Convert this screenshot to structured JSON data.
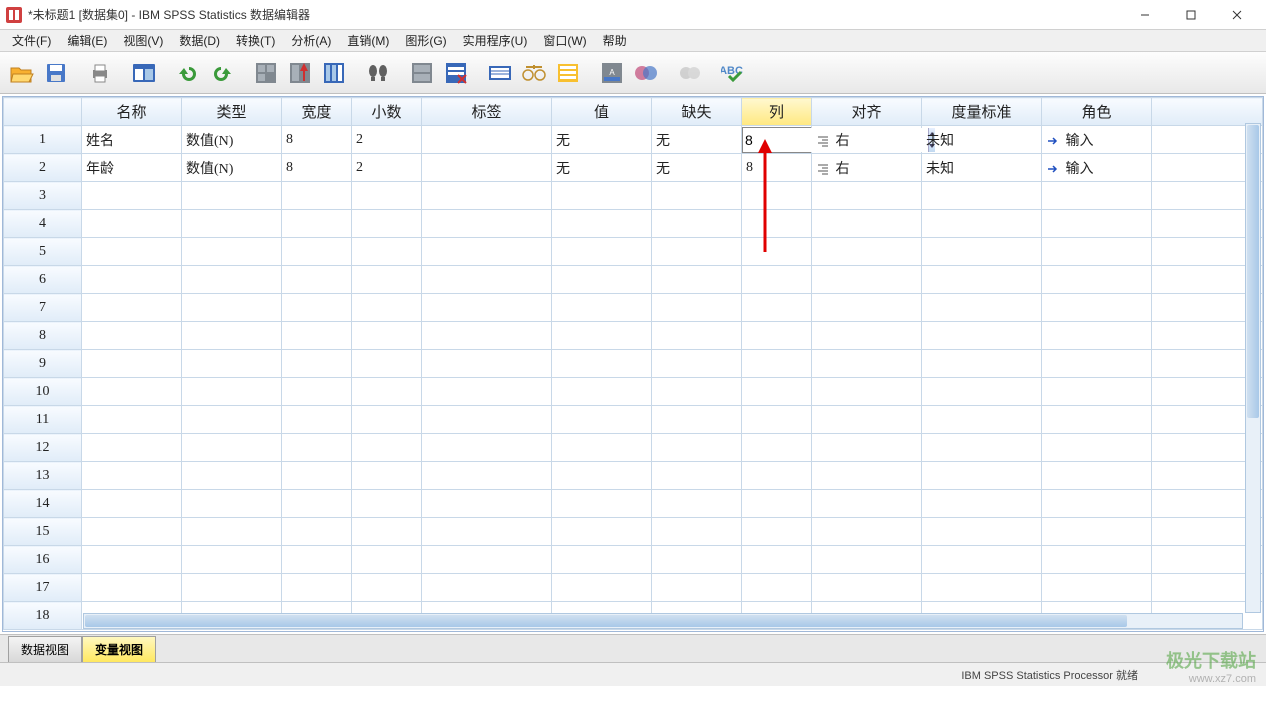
{
  "window": {
    "title": "*未标题1 [数据集0] - IBM SPSS Statistics 数据编辑器"
  },
  "menu": {
    "file": "文件(F)",
    "edit": "编辑(E)",
    "view": "视图(V)",
    "data": "数据(D)",
    "transform": "转换(T)",
    "analyze": "分析(A)",
    "direct": "直销(M)",
    "graphs": "图形(G)",
    "utilities": "实用程序(U)",
    "window": "窗口(W)",
    "help": "帮助"
  },
  "columns": {
    "name": "名称",
    "type": "类型",
    "width": "宽度",
    "decimals": "小数",
    "label": "标签",
    "values": "值",
    "missing": "缺失",
    "columns": "列",
    "align": "对齐",
    "measure": "度量标准",
    "role": "角色"
  },
  "rows": [
    {
      "idx": "1",
      "name": "姓名",
      "type": "数值(N)",
      "width": "8",
      "decimals": "2",
      "label": "",
      "values": "无",
      "missing": "无",
      "columns": "8",
      "align": "右",
      "measure": "未知",
      "role": "输入"
    },
    {
      "idx": "2",
      "name": "年龄",
      "type": "数值(N)",
      "width": "8",
      "decimals": "2",
      "label": "",
      "values": "无",
      "missing": "无",
      "columns": "8",
      "align": "右",
      "measure": "未知",
      "role": "输入"
    }
  ],
  "empty_rows": [
    "3",
    "4",
    "5",
    "6",
    "7",
    "8",
    "9",
    "10",
    "11",
    "12",
    "13",
    "14",
    "15",
    "16",
    "17",
    "18"
  ],
  "tabs": {
    "data_view": "数据视图",
    "variable_view": "变量视图"
  },
  "status": {
    "processor": "IBM SPSS Statistics Processor 就绪"
  },
  "watermark": {
    "brand": "极光下载站",
    "url": "www.xz7.com"
  },
  "active_cell": {
    "row": 0,
    "col": "columns",
    "value": "8"
  }
}
